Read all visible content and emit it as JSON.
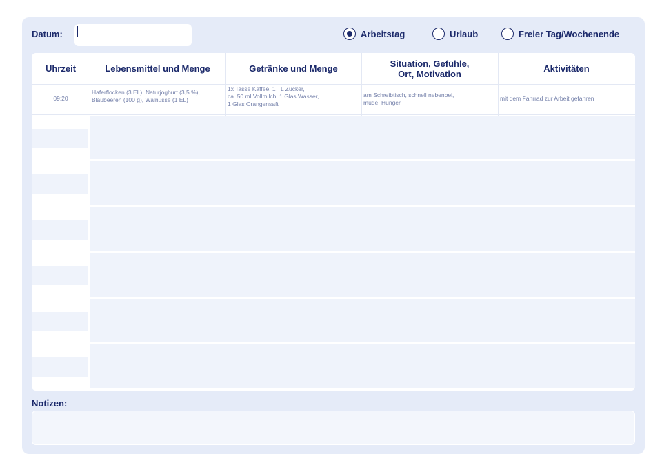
{
  "header": {
    "date_label": "Datum:",
    "date_value": "",
    "options": [
      {
        "label": "Arbeitstag",
        "selected": true
      },
      {
        "label": "Urlaub",
        "selected": false
      },
      {
        "label": "Freier Tag/Wochenende",
        "selected": false
      }
    ]
  },
  "table": {
    "columns": [
      "Uhrzeit",
      "Lebensmittel und Menge",
      "Getränke und Menge",
      "Situation, Gefühle,\nOrt, Motivation",
      "Aktivitäten"
    ],
    "example_row": {
      "time": "09:20",
      "food": "Haferflocken (3 EL), Naturjoghurt (3,5 %),\nBlaubeeren (100 g), Walnüsse (1 EL)",
      "drinks": "1x Tasse Kaffee, 1 TL Zucker,\nca. 50 ml Vollmilch, 1 Glas Wasser,\n1 Glas Orangensaft",
      "situation": "am Schreibtisch, schnell nebenbei,\nmüde, Hunger",
      "activities": "mit dem Fahrrad zur Arbeit gefahren"
    }
  },
  "notes": {
    "label": "Notizen:",
    "value": ""
  },
  "colors": {
    "panel": "#e5ebf8",
    "text": "#1c2a6b",
    "cell": "#eff3fb"
  }
}
